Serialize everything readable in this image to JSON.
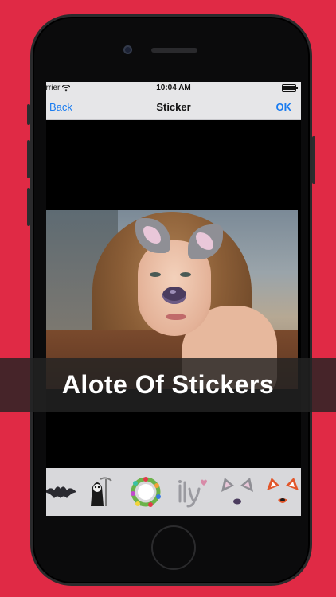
{
  "status_bar": {
    "carrier": "arrier",
    "time": "10:04 AM"
  },
  "nav": {
    "back_label": "Back",
    "title": "Sticker",
    "ok_label": "OK"
  },
  "banner": {
    "text": "Alote Of Stickers"
  },
  "colors": {
    "background": "#e02a45",
    "nav_tint": "#1a7cf0",
    "banner_bg": "#232323"
  },
  "stickers": [
    {
      "name": "bat-sticker"
    },
    {
      "name": "reaper-sticker"
    },
    {
      "name": "floral-wreath-sticker"
    },
    {
      "name": "ily-text-sticker"
    },
    {
      "name": "cat-ears-sticker"
    },
    {
      "name": "fox-ears-sticker"
    }
  ]
}
